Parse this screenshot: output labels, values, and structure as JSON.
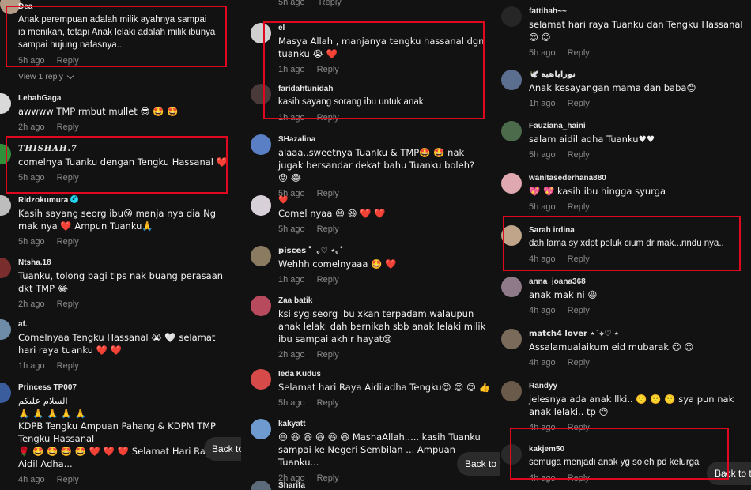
{
  "colors": {
    "background": "#121212",
    "highlight": "#e0081e",
    "muted": "#8a8a8a",
    "heart": "#e41e3f"
  },
  "reply_label": "Reply",
  "back_to_top": "Back to top",
  "column1": {
    "comments": [
      {
        "user": "Dea",
        "text": "Anak perempuan adalah milik ayahnya sampai ia menikah, tetapi Anak lelaki adalah milik ibunya sampai hujung nafasnya...",
        "time": "5h ago",
        "view_replies": "View 1 reply",
        "avatar": "#b59a86"
      },
      {
        "user": "LebahGaga",
        "text": "awwww TMP rmbut mullet 😎 🤩 🤩",
        "time": "2h ago",
        "avatar": "#d9d9d9"
      },
      {
        "user": "THISHAH.7",
        "text": "comelnya Tuanku dengan Tengku Hassanal ❤️",
        "time": "5h ago",
        "avatar": "#2f8f3a"
      },
      {
        "user": "Ridzokumura",
        "text": "Kasih sayang seorg ibu😘 manja nya dia Ng mak nya ❤️ Ampun Tuanku🙏",
        "time": "5h ago",
        "avatar": "#bdbdbd"
      },
      {
        "user": "Ntsha.18",
        "text": "Tuanku, tolong bagi tips nak buang perasaan dkt TMP 😂",
        "time": "2h ago",
        "avatar": "#7a2d2d"
      },
      {
        "user": "af.",
        "text": "Comelnyaa Tengku Hassanal 😭 🤍 selamat hari raya tuanku ❤️ ❤️",
        "time": "1h ago",
        "avatar": "#6e8ca8"
      },
      {
        "user": "Princess TP007",
        "text": "السلام عليكم\n🙏 🙏 🙏 🙏 🙏\nKDPB Tengku Ampuan Pahang & KDPM TMP Tengku Hassanal\n🌹 🤩 🤩 🤩 🤩 ❤️ ❤️ ❤️ Selamat Hari Raya Aidil Adha...",
        "time": "4h ago",
        "avatar": "#3a5d9e"
      }
    ]
  },
  "column2": {
    "top_time": "5h ago",
    "comments": [
      {
        "user": "el",
        "text": "Masya Allah , manjanya tengku hassanal dgn tuanku 😭 ❤️",
        "time": "1h ago",
        "avatar": "#cfcfcf"
      },
      {
        "user": "faridahtunidah",
        "text": "kasih sayang sorang ibu untuk anak",
        "time": "1h ago",
        "avatar": "#4a3a3a"
      },
      {
        "user": "SHazalina",
        "text": "alaaa..sweetnya Tuanku & TMP🤩 🤩 nak jugak bersandar dekat bahu Tuanku boleh? 😝 😂",
        "time": "5h ago",
        "avatar": "#5a7fc4"
      },
      {
        "user": "❤️",
        "text": "Comel nyaa 😆 😆 ❤️ ❤️",
        "time": "5h ago",
        "avatar": "#d8d0d8"
      },
      {
        "user": "pisces ゜｡♡ ⋆｡˚",
        "text": "Wehhh comelnyaaa 🤩 ❤️",
        "time": "1h ago",
        "avatar": "#8b7b60"
      },
      {
        "user": "Zaa batik",
        "text": "ksi syg seorg ibu xkan terpadam.walaupun anak lelaki dah bernikah sbb anak lelaki milik ibu sampai akhir hayat😢",
        "time": "2h ago",
        "avatar": "#b84a5e"
      },
      {
        "user": "Ieda Kudus",
        "text": "Selamat hari Raya Aidiladha Tengku😍 😍 😍 👍",
        "time": "5h ago",
        "avatar": "#d64a4a"
      },
      {
        "user": "kakyatt",
        "text": "😆 😆 😆 😆 😆 😆 MashaAllah..... kasih Tuanku sampai ke Negeri Sembilan ... Ampuan Tuanku...",
        "time": "2h ago",
        "avatar": "#6e9ad0"
      },
      {
        "user": "Sharifa",
        "text": "",
        "time": "",
        "avatar": "#5c6b7a"
      }
    ]
  },
  "column3": {
    "comments": [
      {
        "user": "fattihah~~",
        "text": "selamat hari raya Tuanku dan Tengku Hassanal😍 😊",
        "time": "5h ago",
        "avatar": "#262626"
      },
      {
        "user": "🕊️ نوراياهية",
        "text": "Anak kesayangan mama dan baba😊",
        "time": "1h ago",
        "avatar": "#5b6e8f"
      },
      {
        "user": "Fauziana_haini",
        "text": "salam aidil adha Tuanku♥♥",
        "time": "5h ago",
        "avatar": "#4b6b4b"
      },
      {
        "user": "wanitasederhana880",
        "text": "💖 💖 kasih ibu hingga syurga",
        "time": "5h ago",
        "avatar": "#e0a9b2"
      },
      {
        "user": "Sarah irdina",
        "text": "dah lama sy xdpt peluk cium dr mak...rindu nya..",
        "time": "4h ago",
        "avatar": "#c0a58a"
      },
      {
        "user": "anna_joana368",
        "text": "anak mak ni 😆",
        "time": "4h ago",
        "avatar": "#8f7a8a"
      },
      {
        "user": "match4 lover ⋆˙⟡♡ ⋆",
        "text": "Assalamualaikum eid mubarak ☺ ☺",
        "time": "4h ago",
        "avatar": "#7a6a5a"
      },
      {
        "user": "Randyy",
        "text": "jelesnya ada anak llki.. 🙁 🙁 🙁 sya pun nak anak lelaki.. tp 😔",
        "time": "4h ago",
        "avatar": "#6a5a4a"
      },
      {
        "user": "kakjem50",
        "text": "semuga menjadi anak yg soleh pd kelurga",
        "time": "4h ago",
        "avatar": "#2a2a2a"
      }
    ]
  }
}
